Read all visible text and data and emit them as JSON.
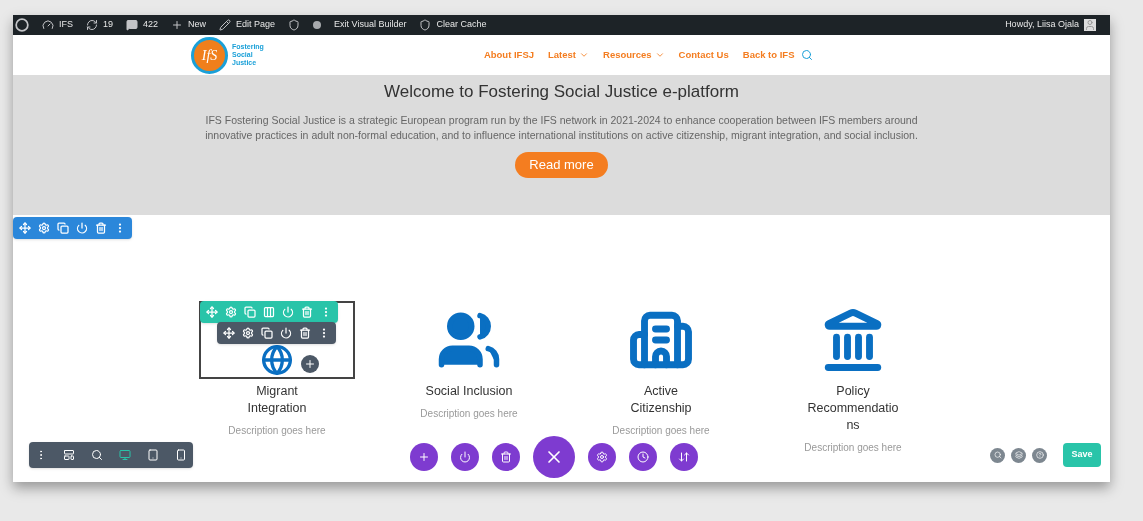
{
  "admin_bar": {
    "items": [
      {
        "kind": "wp-logo"
      },
      {
        "kind": "site",
        "label": "IFS"
      },
      {
        "kind": "updates",
        "label": "19"
      },
      {
        "kind": "comments",
        "label": "422"
      },
      {
        "kind": "new",
        "label": "New"
      },
      {
        "kind": "edit",
        "label": "Edit Page"
      },
      {
        "kind": "seo"
      },
      {
        "kind": "dot"
      },
      {
        "kind": "text",
        "label": "Exit Visual Builder"
      },
      {
        "kind": "cache",
        "label": "Clear Cache"
      }
    ],
    "greeting": "Howdy, Liisa Ojala"
  },
  "logo": {
    "mark": "IfS",
    "lines": [
      "Fostering",
      "Social",
      "Justice"
    ]
  },
  "nav": [
    {
      "label": "About IFSJ",
      "dropdown": false
    },
    {
      "label": "Latest",
      "dropdown": true
    },
    {
      "label": "Resources",
      "dropdown": true
    },
    {
      "label": "Contact Us",
      "dropdown": false
    },
    {
      "label": "Back to IFS",
      "dropdown": false
    }
  ],
  "hero": {
    "title": "Welcome to Fostering Social Justice e-platform",
    "body": "IFS Fostering Social Justice is a strategic European program run by the IFS network in 2021-2024 to enhance cooperation between IFS members around innovative practices in adult non-formal education, and to influence international institutions on active citizenship, migrant integration, and social inclusion.",
    "button": "Read more"
  },
  "features": [
    {
      "kind": "globe",
      "title": "Migrant Integration",
      "description": "Description goes here",
      "selected": true
    },
    {
      "kind": "people",
      "title": "Social Inclusion",
      "description": "Description goes here",
      "selected": false
    },
    {
      "kind": "buildings",
      "title": "Active Citizenship",
      "description": "Description goes here",
      "selected": false
    },
    {
      "kind": "landmark",
      "title": "Policy Recommendations",
      "description": "Description goes here",
      "selected": false
    }
  ],
  "view_modes": [
    {
      "kind": "menu",
      "selected": false
    },
    {
      "kind": "wireframe",
      "selected": false
    },
    {
      "kind": "zoom",
      "selected": false
    },
    {
      "kind": "desktop",
      "selected": true
    },
    {
      "kind": "tablet",
      "selected": false
    },
    {
      "kind": "phone",
      "selected": false
    }
  ],
  "save_button": "Save"
}
